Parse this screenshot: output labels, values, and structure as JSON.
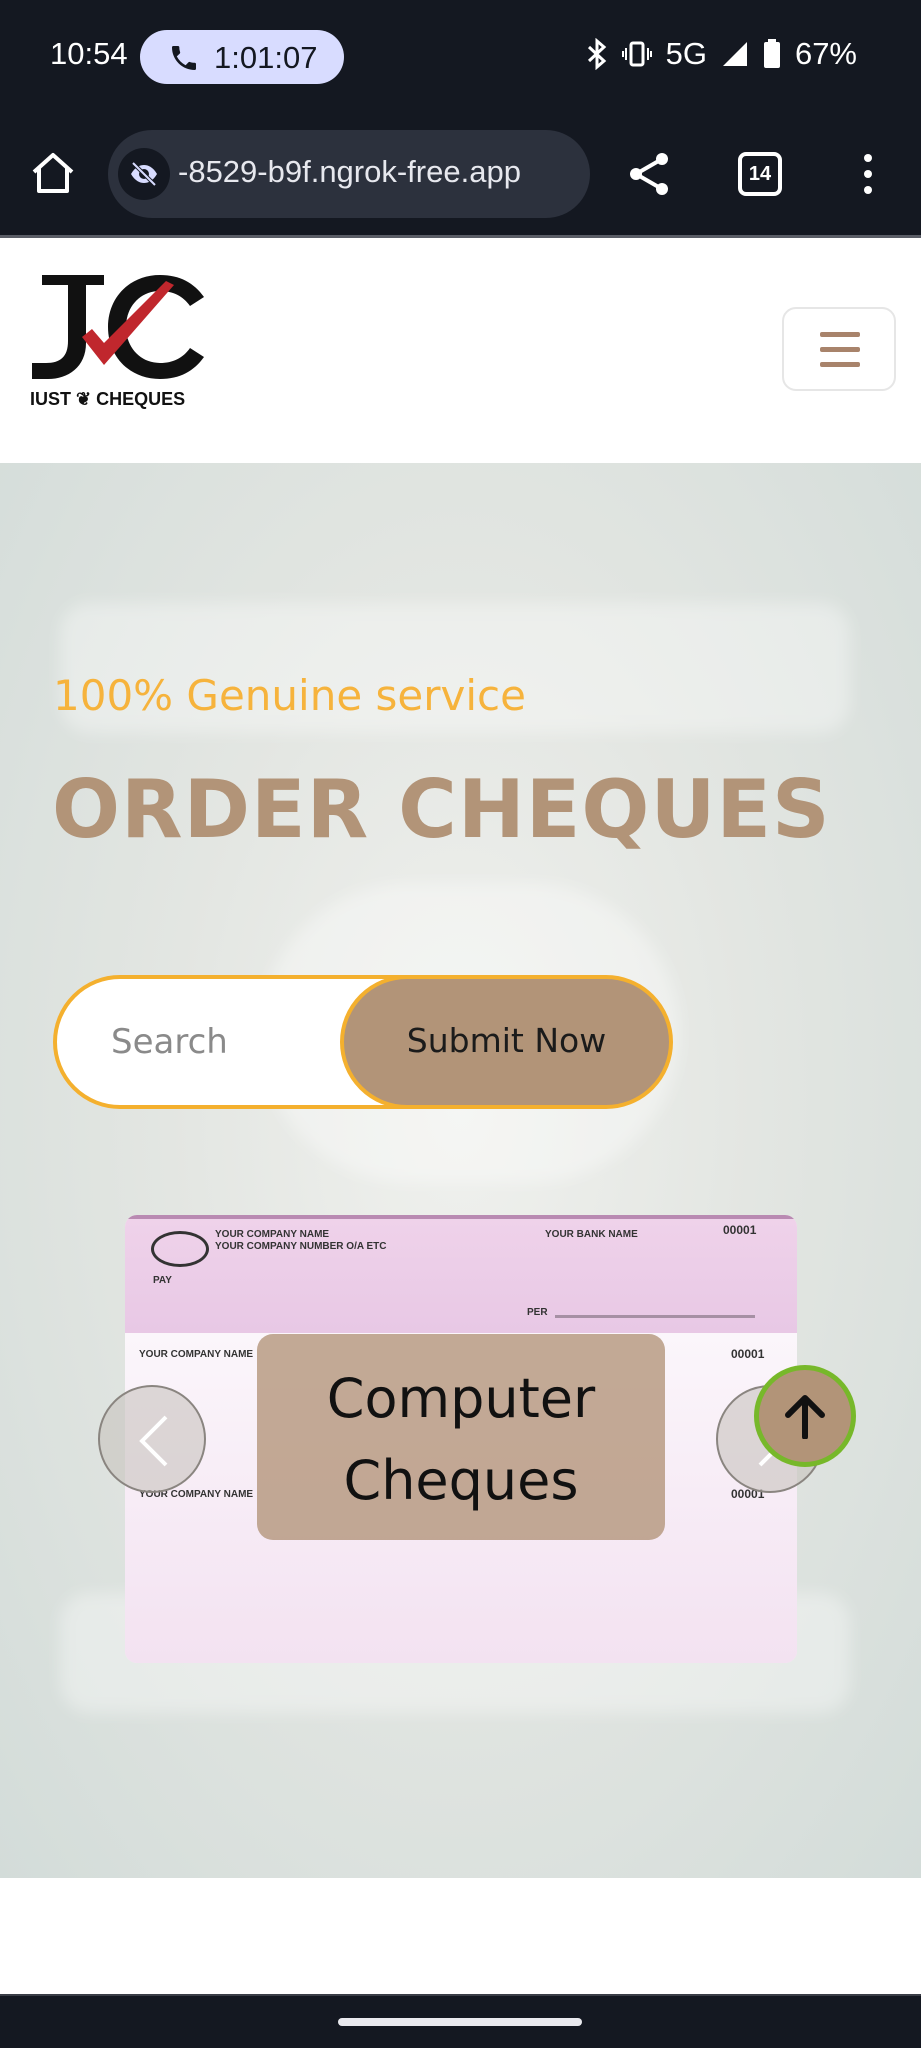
{
  "status_bar": {
    "time": "10:54",
    "call_duration": "1:01:07",
    "network": "5G",
    "battery": "67%"
  },
  "browser": {
    "url": "-8529-b9f.ngrok-free.app",
    "tab_count": "14"
  },
  "site": {
    "logo_text": "IUST ❦ CHEQUES",
    "logo_alt": "JC",
    "brand_color": "#b29478",
    "accent_color": "#f6b33c"
  },
  "hero": {
    "tagline": "100% Genuine service",
    "title": "ORDER CHEQUES",
    "search_placeholder": "Search",
    "submit_label": "Submit Now"
  },
  "carousel": {
    "caption": "Computer Cheques",
    "cheque_labels": {
      "company_name": "YOUR COMPANY NAME",
      "company_number": "YOUR COMPANY NUMBER O/A ETC",
      "bank_name": "YOUR BANK NAME",
      "cheque_number": "00001",
      "pay": "PAY",
      "per": "PER"
    },
    "prev_icon": "chevron-left-icon",
    "next_icon": "chevron-right-icon"
  },
  "back_to_top_icon": "arrow-up-icon"
}
